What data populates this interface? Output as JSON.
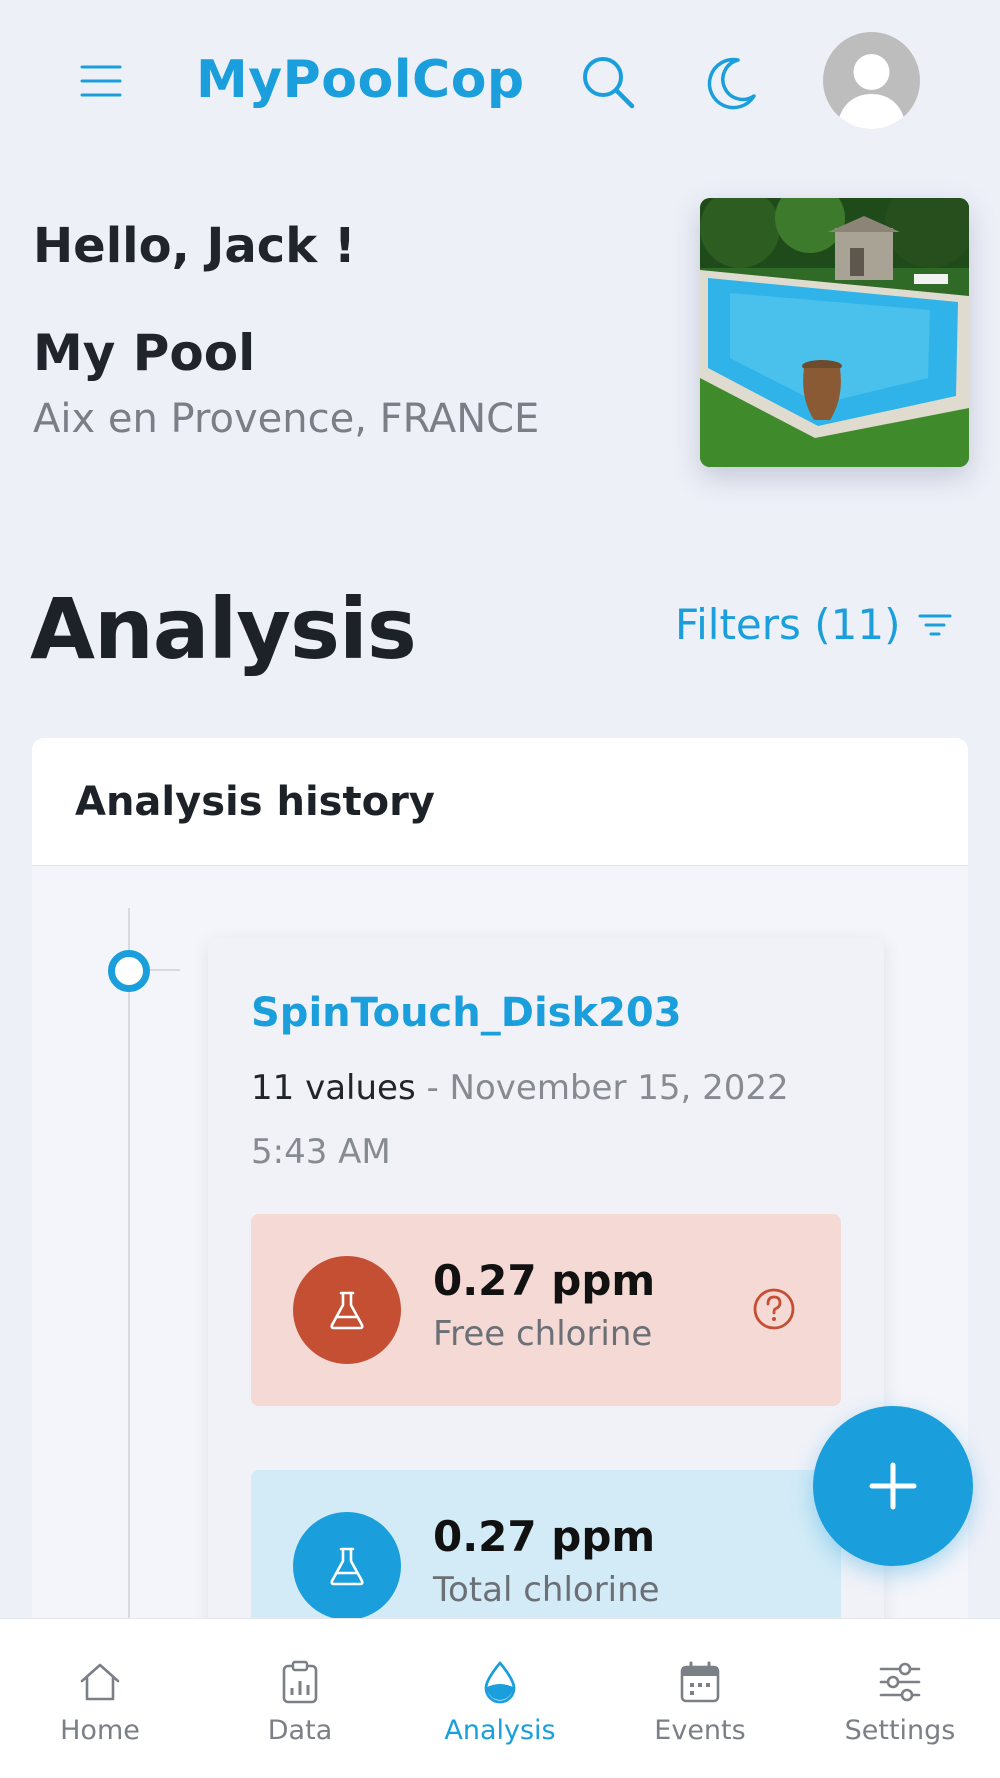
{
  "app": {
    "title": "MyPoolCop"
  },
  "greeting": "Hello, Jack !",
  "pool": {
    "name": "My Pool",
    "location": "Aix en Provence, FRANCE"
  },
  "page": {
    "title": "Analysis",
    "filters_label": "Filters (11)"
  },
  "history": {
    "title": "Analysis history",
    "entries": [
      {
        "name": "SpinTouch_Disk203",
        "count": "11 values",
        "separator": " - ",
        "date": "November 15, 2022 5:43 AM",
        "values": [
          {
            "value": "0.27 ppm",
            "label": "Free chlorine",
            "status_color": "#c44f33"
          },
          {
            "value": "0.27 ppm",
            "label": "Total chlorine",
            "status_color": "#1a9fdc"
          }
        ]
      }
    ]
  },
  "nav": {
    "items": [
      {
        "label": "Home",
        "icon": "home-icon"
      },
      {
        "label": "Data",
        "icon": "clipboard-chart-icon"
      },
      {
        "label": "Analysis",
        "icon": "water-drop-icon",
        "active": true
      },
      {
        "label": "Events",
        "icon": "calendar-icon"
      },
      {
        "label": "Settings",
        "icon": "sliders-icon"
      }
    ]
  },
  "colors": {
    "accent": "#1a9fdc",
    "alert": "#c44f33",
    "background": "#eef0f8"
  }
}
